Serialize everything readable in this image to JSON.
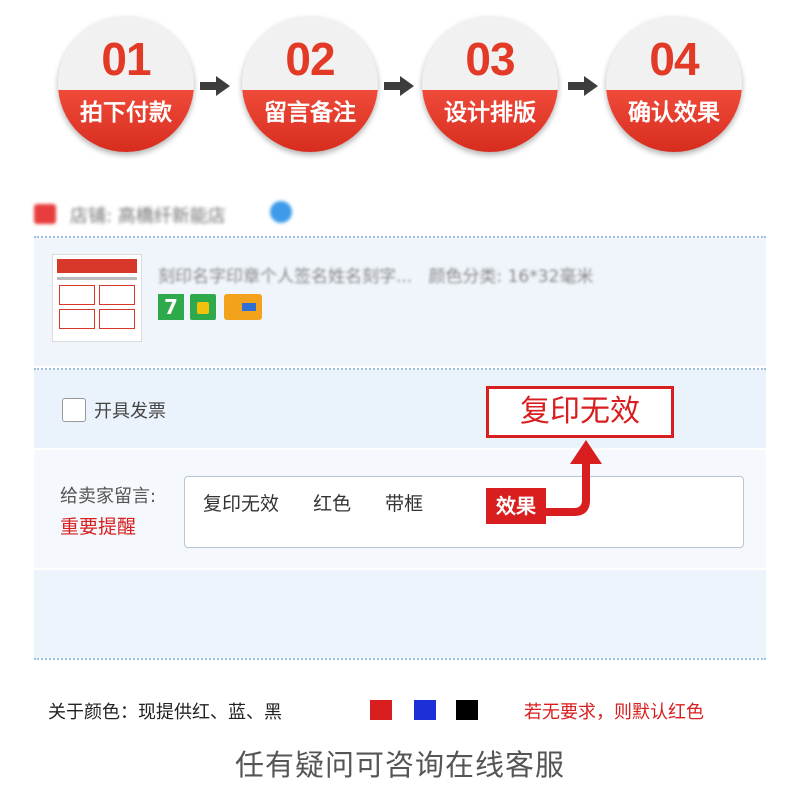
{
  "steps": [
    {
      "number": "01",
      "label": "拍下付款"
    },
    {
      "number": "02",
      "label": "留言备注"
    },
    {
      "number": "03",
      "label": "设计排版"
    },
    {
      "number": "04",
      "label": "确认效果"
    }
  ],
  "shop": {
    "name": "店铺: 高橋纤新能店",
    "logo_icon": "shop-logo-icon",
    "badge_icon": "verified-badge-icon"
  },
  "product": {
    "title": "刻印名字印章个人签名姓名刻字...",
    "sku": "颜色分类: 16*32毫米",
    "badges": [
      "7",
      "bag-icon",
      "card-icon"
    ]
  },
  "invoice": {
    "label": "开具发票",
    "checked": false
  },
  "message": {
    "label": "给卖家留言:",
    "note": "重要提醒",
    "items": [
      "复印无效",
      "红色",
      "带框"
    ]
  },
  "annotation": {
    "result_text": "复印无效",
    "effect_tag": "效果"
  },
  "colors": {
    "label": "关于颜色：现提供红、蓝、黑",
    "swatches": [
      "#d81e1e",
      "#1a2fd6",
      "#000000"
    ],
    "default_note": "若无要求，则默认红色"
  },
  "footer": {
    "consult": "任有疑问可咨询在线客服"
  },
  "theme": {
    "accent_red": "#e23a26",
    "panel_blue": "#f0f5fb"
  }
}
